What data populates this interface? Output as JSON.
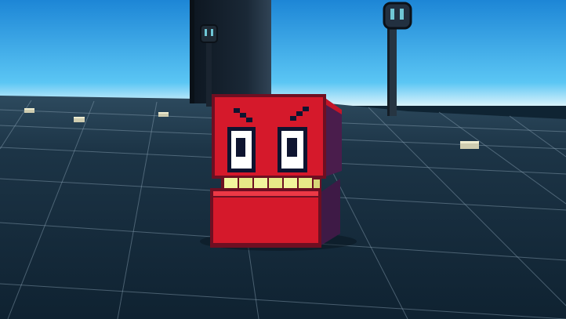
{
  "scene": {
    "sky_top_color": "#1d86d6",
    "sky_horizon_color": "#5bc6f4",
    "haze_color": "#d8f2fb",
    "floor_color": "#1c3446",
    "grid_color": "#8ea6b8",
    "tower_color": "#121c28"
  },
  "lamps": [
    {
      "name": "lamp-post-left",
      "icon": "lantern-icon"
    },
    {
      "name": "lamp-post-right",
      "icon": "lantern-icon"
    }
  ],
  "pickups": [
    {
      "name": "pickup-block"
    },
    {
      "name": "pickup-block"
    },
    {
      "name": "pickup-block"
    },
    {
      "name": "pickup-block"
    }
  ],
  "character": {
    "name": "red-cube-monster",
    "body_color": "#d5192b",
    "outline_color": "#6e0f22",
    "side_color": "#4a1d4c",
    "teeth_color": "#f2f59c",
    "eye_white": "#ffffff",
    "pupil_color": "#0e1430"
  }
}
